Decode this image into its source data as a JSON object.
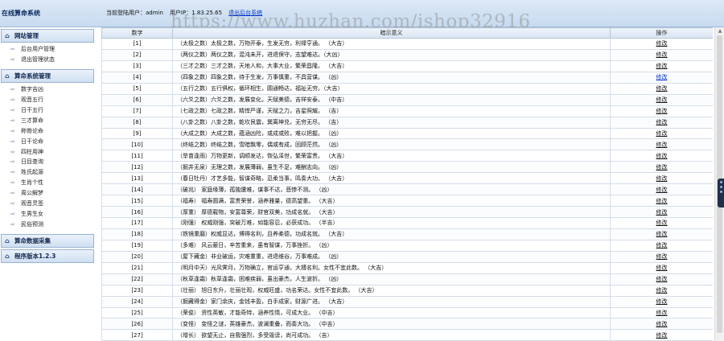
{
  "header": {
    "brand": "在线算命系统",
    "user_label": "当前登陆用户：admin",
    "ip_label": "用户IP：1.83.25.65",
    "logout": "退出后台系统",
    "watermark": "https://www.huzhan.com/ishop32916"
  },
  "sidebar": {
    "sections": [
      {
        "title": "网站管理",
        "icon": "home-icon",
        "items": [
          "后台用户管理",
          "退出管理状态"
        ]
      },
      {
        "title": "算命系统管理",
        "icon": "home-icon",
        "items": [
          "数字吉凶",
          "观音五行",
          "日干五行",
          "三才算命",
          "称骨论命",
          "日干论命",
          "四柱用神",
          "日目查询",
          "姓氏起源",
          "生肖个性",
          "周公解梦",
          "观音灵签",
          "生男生女",
          "民俗预测"
        ]
      },
      {
        "title": "算命数据采集",
        "icon": "home-icon",
        "items": []
      },
      {
        "title": "程序版本1.2.3",
        "icon": "home-icon",
        "items": []
      }
    ]
  },
  "table": {
    "headers": [
      "数字",
      "暗示意义",
      "操作"
    ],
    "op_label": "修改",
    "rows": [
      {
        "num": "[1]",
        "desc": "（太极之数）太极之数，万物开泰，生发无穷，利禄亨通。  （大吉）"
      },
      {
        "num": "[2]",
        "desc": "（两仪之数）两仪之数，混沌未开，进退保守，志望难达。（大凶）"
      },
      {
        "num": "[3]",
        "desc": "（三才之数）三才之数，天地人和，大事大业，繁荣昌隆。  （大吉）"
      },
      {
        "num": "[4]",
        "desc": "（四象之数）四象之数，待于生发，万事慎重，不具营谋。  （凶）"
      },
      {
        "num": "[5]",
        "desc": "（五行之数）五行俱权，循环相生，圆通畅达，福祉无穷。（大吉）"
      },
      {
        "num": "[6]",
        "desc": "（六爻之数）六爻之数，发展变化，天赋美德，吉祥安泰。  （中吉）"
      },
      {
        "num": "[7]",
        "desc": "（七政之数）七政之数，精悍严谨，天赋之力，吉星照耀。  （吉）"
      },
      {
        "num": "[8]",
        "desc": "（八卦之数）八卦之数，乾坎艮震，巽离坤兑，无穷无尽。  （吉）"
      },
      {
        "num": "[9]",
        "desc": "（大成之数）大成之数，蕴涵凶险，或成或败，难以把握。  （凶）"
      },
      {
        "num": "[10]",
        "desc": "（终结之数）终结之数，雪暗飘零，偶或有成，回顾茫然。  （凶）"
      },
      {
        "num": "[11]",
        "desc": "（旱苗逢雨）万物更新，调顺发达，恢弘泽世，繁荣富贵。  （大吉）"
      },
      {
        "num": "[12]",
        "desc": "（掘井无泉）无理之数，发展薄弱，虽生不足，难酬志向。  （凶）"
      },
      {
        "num": "[13]",
        "desc": "（春日牡丹）才艺多能，智谋奇略，忍柔当事，鸣奏大功。  （大吉）"
      },
      {
        "num": "[14]",
        "desc": "（破兆）  家庭缘薄，孤独遭难，谋事不达，悲惨不测。  （凶）"
      },
      {
        "num": "[15]",
        "desc": "（福寿）  福寿圆满，富贵荣誉，涵养雅量，德高望重。  （大吉）"
      },
      {
        "num": "[16]",
        "desc": "（厚重）  厚德载物，安富尊荣，财官双美，功成名就。  （大吉）"
      },
      {
        "num": "[17]",
        "desc": "（刚强）  权威刚强，突破万难，如能容忍，必获成功。    （半吉）"
      },
      {
        "num": "[18]",
        "desc": "（铁镜重磨）权威显达，博得名利，且养柔德，功成名就。  （大吉）"
      },
      {
        "num": "[19]",
        "desc": "（多难）  风云蔽日，辛苦重来，虽有智谋，万事挫折。  （凶）"
      },
      {
        "num": "[20]",
        "desc": "（屋下藏金）非业破运，灾难重重，进退维谷，万事难成。  （凶）"
      },
      {
        "num": "[21]",
        "desc": "（明月中天）光风霁月，万物确立，官运亨通，大搏名利。女性不宜此数。  （大吉）"
      },
      {
        "num": "[22]",
        "desc": "（秋草逢霜）秋草逢霜，困难疾弱，虽出豪杰，人生波折。  （凶）"
      },
      {
        "num": "[23]",
        "desc": "（壮丽）  旭日东升，壮丽壮观，权威旺盛，功名荣达。女性不宜此数。  （大吉）"
      },
      {
        "num": "[24]",
        "desc": "（掘藏得金）家门余庆，金钱丰盈，白手成家，财源广进。  （大吉）"
      },
      {
        "num": "[25]",
        "desc": "（荣俊）  资性英敏，才能奇特，涵养性情，可成大业。    （中吉）"
      },
      {
        "num": "[26]",
        "desc": "（变怪）  变怪之谜，英雄豪杰，波澜重叠，而奏大功。    （中吉）"
      },
      {
        "num": "[27]",
        "desc": "（增长）  欲望无止，自我强烈，多受毁谤，尚可成功。  （吉）"
      }
    ]
  }
}
